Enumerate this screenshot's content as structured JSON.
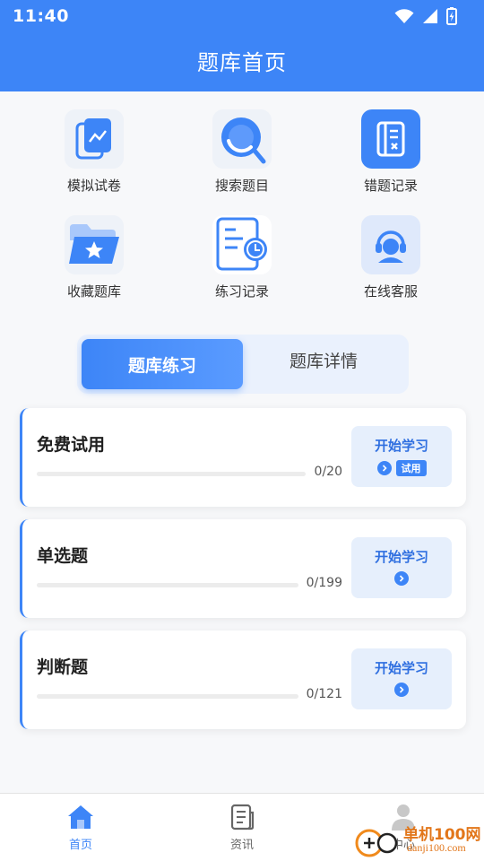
{
  "status_bar": {
    "time": "11:40"
  },
  "header": {
    "title": "题库首页"
  },
  "grid": [
    {
      "label": "模拟试卷",
      "icon": "exam-paper-icon"
    },
    {
      "label": "搜索题目",
      "icon": "search-icon"
    },
    {
      "label": "错题记录",
      "icon": "wrong-answers-icon"
    },
    {
      "label": "收藏题库",
      "icon": "star-folder-icon"
    },
    {
      "label": "练习记录",
      "icon": "practice-record-icon"
    },
    {
      "label": "在线客服",
      "icon": "customer-service-icon"
    }
  ],
  "tabs": {
    "active": "题库练习",
    "inactive": "题库详情"
  },
  "cards": [
    {
      "title": "免费试用",
      "count": "0/20",
      "progress": 0,
      "button": "开始学习",
      "badge": "试用"
    },
    {
      "title": "单选题",
      "count": "0/199",
      "progress": 0,
      "button": "开始学习"
    },
    {
      "title": "判断题",
      "count": "0/121",
      "progress": 0,
      "button": "开始学习"
    }
  ],
  "bottom_nav": [
    {
      "label": "首页",
      "icon": "home-icon",
      "active": true
    },
    {
      "label": "资讯",
      "icon": "news-icon",
      "active": false
    },
    {
      "label": "中心",
      "icon": "profile-icon",
      "active": false
    }
  ],
  "watermark": {
    "brand": "单机100网",
    "url": "danji100.com"
  },
  "colors": {
    "primary": "#3d85f7",
    "button_bg": "#e6effc",
    "page_bg": "#f7f8fa"
  }
}
